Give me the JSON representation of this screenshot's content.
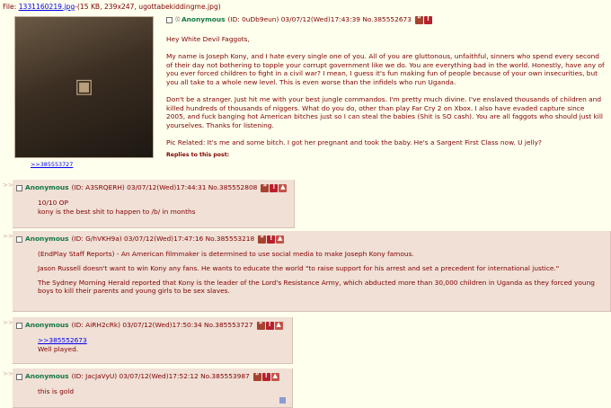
{
  "file": {
    "prefix": "File:",
    "link": "1331160219.jpg",
    "details": "-(15 KB, 239x247, ugottabekiddingme.jpg)"
  },
  "op": {
    "name": "Anonymous",
    "meta": "(ID: 0uDb9eun) 03/07/12(Wed)17:43:39 No.385552673",
    "paragraphs": [
      "Hey White Devil Faggots,",
      "My name is Joseph Kony, and I hate every single one of you. All of you are gluttonous, unfaithful, sinners who spend every second of their day not bothering to topple your corrupt government like we do. You are everything bad in the world. Honestly, have any of you ever forced children to fight in a civil war? I mean, I guess it's fun making fun of people because of your own insecurities, but you all take to a whole new level. This is even worse than the infidels who run Uganda.",
      "Don't be a stranger. Just hit me with your best jungle commandos. I'm pretty much divine. I've enslaved thousands of children and killed hundreds of thousands of niggers. What do you do, other than play Far Cry 2 on Xbox. I also have evaded capture since 2005, and fuck banging hot American bitches just so I can steal the babies (Shit is SO cash). You are all faggots who should just kill yourselves. Thanks for listening.",
      "Pic Related: It's me and some bitch. I got her pregnant and took the baby. He's a Sargent First Class now. U jelly?"
    ],
    "replies_label": "Replies to this post:",
    "backlink": ">>385553727"
  },
  "replies": [
    {
      "name": "Anonymous",
      "meta": "(ID: A3SRQERH) 03/07/12(Wed)17:44:31 No.385552808",
      "lines": [
        "10/10 OP",
        "kony is the best shit to happen to /b/ in months"
      ]
    },
    {
      "name": "Anonymous",
      "meta": "(ID: G/hVKH9a) 03/07/12(Wed)17:47:16 No.385553218",
      "paragraphs": [
        "(EndPlay Staff Reports) - An American filmmaker is determined to use social media to make Joseph Kony famous.",
        "Jason Russell doesn't want to win Kony any fans. He wants to educate the world \"to raise support for his arrest and set a precedent for international justice.\"",
        "The Sydney Morning Herald reported that Kony is the leader of the Lord's Resistance Army, which abducted more than 30,000 children in Uganda as they forced young boys to kill their parents and young girls to be sex slaves."
      ]
    },
    {
      "name": "Anonymous",
      "meta": "(ID: AiRH2cRk) 03/07/12(Wed)17:50:34 No.385553727",
      "quote": ">>385552673",
      "text": "Well played."
    },
    {
      "name": "Anonymous",
      "meta": "(ID: JacJaVyU) 03/07/12(Wed)17:52:12 No.385553987",
      "text": "this is gold"
    }
  ],
  "arrows": ">>",
  "colors": {
    "background": "#FFFFEE",
    "reply": "#F0E0D6",
    "name": "#117743",
    "text": "#800000",
    "link": "#0000EE"
  }
}
